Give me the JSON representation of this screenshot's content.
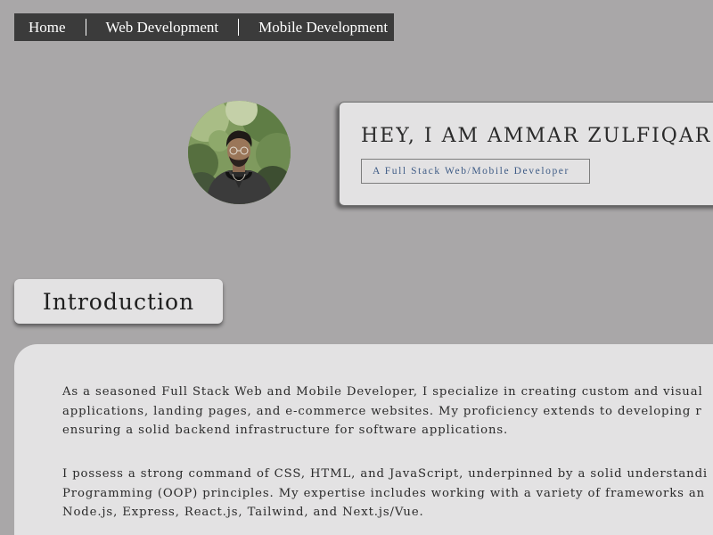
{
  "nav": {
    "items": [
      {
        "label": "Home"
      },
      {
        "label": "Web Development"
      },
      {
        "label": "Mobile Development"
      }
    ]
  },
  "hero": {
    "title": "HEY, I AM AMMAR ZULFIQAR",
    "subtitle": "A Full Stack Web/Mobile Developer"
  },
  "intro": {
    "heading": "Introduction",
    "paragraphs": [
      {
        "lines": [
          "As a seasoned Full Stack Web and Mobile Developer, I specialize in creating custom and visual",
          "applications, landing pages, and e-commerce websites. My proficiency extends to developing r",
          "ensuring a solid backend infrastructure for software applications."
        ]
      },
      {
        "lines": [
          "I possess a strong command of CSS, HTML, and JavaScript, underpinned by a solid understandi",
          "Programming (OOP) principles. My expertise includes working with a variety of frameworks an",
          "Node.js, Express, React.js, Tailwind, and Next.js/Vue."
        ]
      }
    ]
  },
  "colors": {
    "page_background": "#a9a7a8",
    "navbar_background": "#3b3b3b",
    "card_background": "#e3e2e3",
    "subtitle_text": "#3f5c86"
  },
  "icons": {
    "avatar": "profile-photo"
  }
}
